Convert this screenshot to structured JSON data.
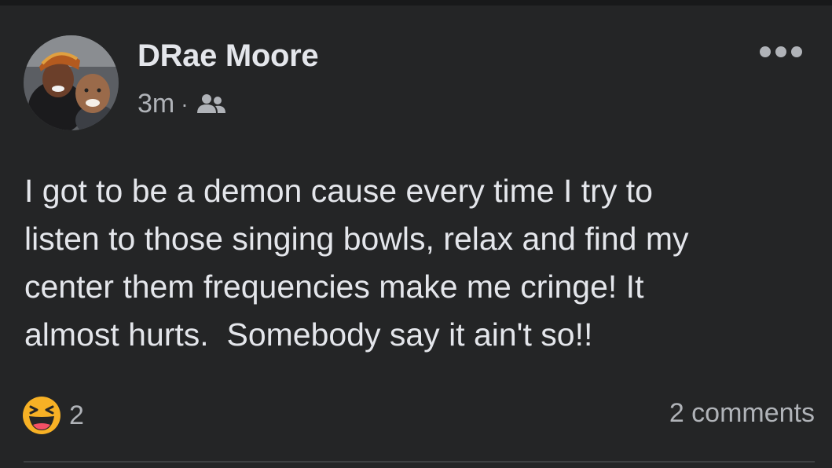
{
  "post": {
    "author": "DRae Moore",
    "time": "3m",
    "separator": "·",
    "audience_icon": "friends-icon",
    "more_icon": "more-options-icon",
    "text": "I got to be a demon cause every time I try to\nlisten to those singing bowls, relax and find my\ncenter them frequencies make me cringe! It\nalmost hurts.  Somebody say it ain't so!!",
    "reaction_icon": "haha-reaction-icon",
    "reaction_count": "2",
    "comments_label": "2 comments"
  },
  "colors": {
    "background": "#242526",
    "top_bar": "#18191a",
    "primary_text": "#e4e6eb",
    "secondary_text": "#b0b3b8",
    "divider": "#3e4042",
    "haha_yellow": "#f7b125"
  }
}
